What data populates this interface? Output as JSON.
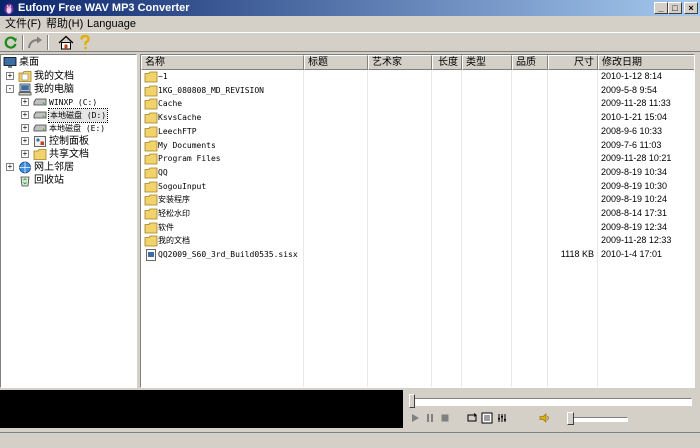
{
  "window": {
    "title": "Eufony Free WAV MP3 Converter",
    "app_icon": "penguin-icon",
    "controls": [
      "minimize",
      "maximize",
      "close"
    ]
  },
  "menu": [
    {
      "label": "文件(F)"
    },
    {
      "label": "帮助(H)"
    },
    {
      "label": "Language"
    }
  ],
  "toolbar": [
    {
      "icon": "refresh-icon"
    },
    {
      "icon": "forward-arrow-icon"
    },
    {
      "icon": "home-icon"
    },
    {
      "icon": "help-question-icon"
    }
  ],
  "tree": {
    "nodes": [
      {
        "label": "桌面",
        "icon": "desktop-icon"
      },
      {
        "label": "我的文档",
        "icon": "my-documents-icon",
        "expander": "+"
      },
      {
        "label": "我的电脑",
        "icon": "my-computer-icon",
        "expander": "-"
      },
      {
        "label": "WINXP (C:)",
        "icon": "drive-icon",
        "expander": "+"
      },
      {
        "label": "本地磁盘 (D:)",
        "icon": "drive-icon",
        "expander": "+",
        "selected": true
      },
      {
        "label": "本地磁盘 (E:)",
        "icon": "drive-icon",
        "expander": "+"
      },
      {
        "label": "控制面板",
        "icon": "control-panel-icon",
        "expander": "+"
      },
      {
        "label": "共享文档",
        "icon": "folder-icon",
        "expander": "+"
      },
      {
        "label": "网上邻居",
        "icon": "network-icon",
        "expander": "+"
      },
      {
        "label": "回收站",
        "icon": "recycle-bin-icon"
      }
    ]
  },
  "file_list": {
    "columns": [
      "名称",
      "标题",
      "艺术家",
      "长度",
      "类型",
      "品质",
      "尺寸",
      "修改日期"
    ],
    "rows": [
      {
        "name": "~1",
        "icon": "folder-icon",
        "size": "",
        "date": "2010-1-12 8:14"
      },
      {
        "name": "1KG_080808_MD_REVISION",
        "icon": "folder-icon",
        "size": "",
        "date": "2009-5-8 9:54"
      },
      {
        "name": "Cache",
        "icon": "folder-icon",
        "size": "",
        "date": "2009-11-28 11:33"
      },
      {
        "name": "KsvsCache",
        "icon": "folder-icon",
        "size": "",
        "date": "2010-1-21 15:04"
      },
      {
        "name": "LeechFTP",
        "icon": "folder-icon",
        "size": "",
        "date": "2008-9-6 10:33"
      },
      {
        "name": "My Documents",
        "icon": "folder-icon",
        "size": "",
        "date": "2009-7-6 11:03"
      },
      {
        "name": "Program Files",
        "icon": "folder-icon",
        "size": "",
        "date": "2009-11-28 10:21"
      },
      {
        "name": "QQ",
        "icon": "folder-icon",
        "size": "",
        "date": "2009-8-19 10:34"
      },
      {
        "name": "SogouInput",
        "icon": "folder-icon",
        "size": "",
        "date": "2009-8-19 10:30"
      },
      {
        "name": "安装程序",
        "icon": "folder-icon",
        "size": "",
        "date": "2009-8-19 10:24"
      },
      {
        "name": "轻松水印",
        "icon": "folder-icon",
        "size": "",
        "date": "2008-8-14 17:31"
      },
      {
        "name": "软件",
        "icon": "folder-icon",
        "size": "",
        "date": "2009-8-19 12:34"
      },
      {
        "name": "我的文档",
        "icon": "folder-icon",
        "size": "",
        "date": "2009-11-28 12:33"
      },
      {
        "name": "QQ2009_S60_3rd_Build0535.sisx",
        "icon": "file-icon",
        "size": "1118 KB",
        "date": "2010-1-4 17:01"
      }
    ]
  },
  "player": {
    "controls": [
      "play-icon",
      "pause-icon",
      "stop-icon",
      "repeat-icon",
      "playlist-icon",
      "equalizer-icon",
      "volume-icon"
    ],
    "seek_position": 0.0,
    "volume_level": 0.0
  }
}
